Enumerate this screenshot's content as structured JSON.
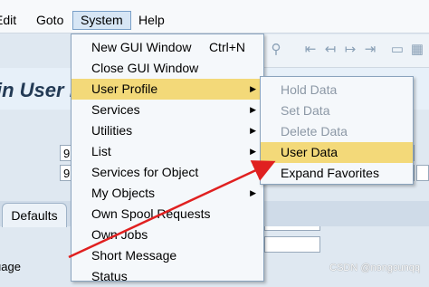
{
  "menubar": {
    "items": [
      "Edit",
      "Goto",
      "System",
      "Help"
    ]
  },
  "title": {
    "text": "in User P"
  },
  "fields": [
    "9",
    "9"
  ],
  "tabs": {
    "defaults": "Defaults"
  },
  "language_label": "uage",
  "system_menu": {
    "items": [
      {
        "label": "New GUI Window",
        "shortcut": "Ctrl+N"
      },
      {
        "label": "Close GUI Window",
        "shortcut": ""
      },
      {
        "label": "User Profile",
        "shortcut": ""
      },
      {
        "label": "Services",
        "shortcut": ""
      },
      {
        "label": "Utilities",
        "shortcut": ""
      },
      {
        "label": "List",
        "shortcut": ""
      },
      {
        "label": "Services for Object",
        "shortcut": ""
      },
      {
        "label": "My Objects",
        "shortcut": ""
      },
      {
        "label": "Own Spool Requests",
        "shortcut": ""
      },
      {
        "label": "Own Jobs",
        "shortcut": ""
      },
      {
        "label": "Short Message",
        "shortcut": ""
      },
      {
        "label": "Status",
        "shortcut": ""
      }
    ]
  },
  "profile_submenu": {
    "items": [
      {
        "label": "Hold Data",
        "enabled": false
      },
      {
        "label": "Set Data",
        "enabled": false
      },
      {
        "label": "Delete Data",
        "enabled": false
      },
      {
        "label": "User Data",
        "enabled": true
      },
      {
        "label": "Expand Favorites",
        "enabled": true
      }
    ]
  },
  "watermark": "CSDN @nongcunqq",
  "colors": {
    "highlight": "#f3d979",
    "arrow": "#e02020",
    "title": "#233a55"
  }
}
